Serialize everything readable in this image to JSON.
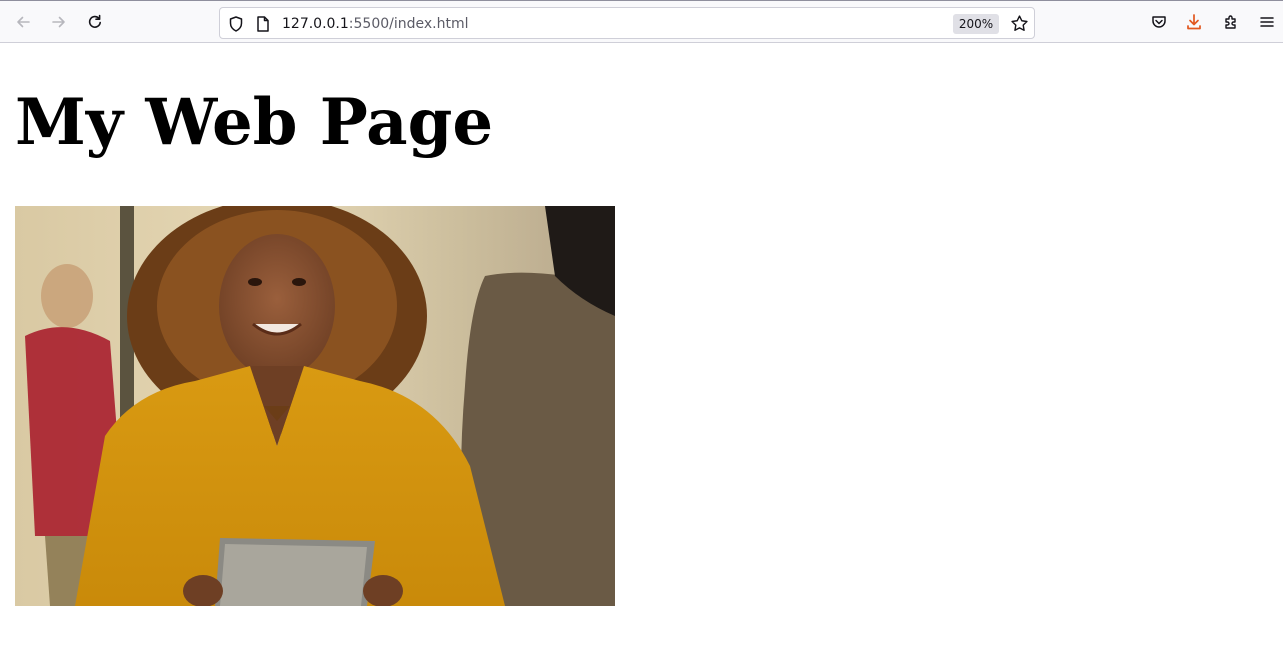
{
  "browser": {
    "url_host": "127.0.0.1",
    "url_rest": ":5500/index.html",
    "zoom": "200%",
    "icons": {
      "back": "arrow-left-icon",
      "forward": "arrow-right-icon",
      "reload": "reload-icon",
      "site_info": "shield-icon",
      "page": "page-icon",
      "bookmark": "star-icon",
      "pocket": "pocket-icon",
      "downloads": "download-icon",
      "extensions": "puzzle-icon",
      "menu": "hamburger-menu-icon"
    },
    "colors": {
      "download_accent": "#e2571e"
    }
  },
  "page": {
    "title": "My Web Page",
    "image": {
      "subject": "woman in a yellow blouse holding a tablet"
    }
  }
}
